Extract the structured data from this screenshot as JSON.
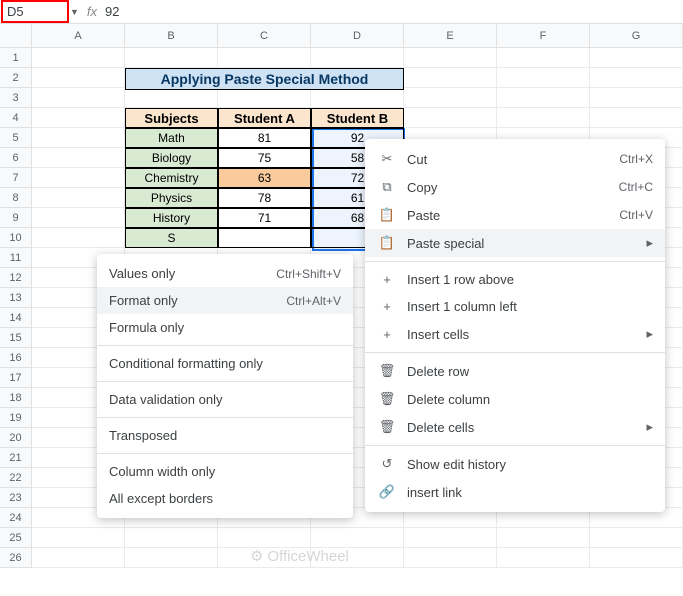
{
  "nameBox": "D5",
  "formulaValue": "92",
  "cols": [
    "A",
    "B",
    "C",
    "D",
    "E",
    "F",
    "G"
  ],
  "title": "Applying Paste Special Method",
  "headers": {
    "b": "Subjects",
    "c": "Student A",
    "d": "Student B"
  },
  "rows": [
    {
      "sub": "Math",
      "a": "81",
      "b": "92"
    },
    {
      "sub": "Biology",
      "a": "75",
      "b": "58"
    },
    {
      "sub": "Chemistry",
      "a": "63",
      "b": "72"
    },
    {
      "sub": "Physics",
      "a": "78",
      "b": "61"
    },
    {
      "sub": "History",
      "a": "71",
      "b": "68"
    },
    {
      "sub": "S",
      "a": "",
      "b": ""
    }
  ],
  "ctx": {
    "cut": "Cut",
    "copy": "Copy",
    "paste": "Paste",
    "pasteSpecial": "Paste special",
    "insRow": "Insert 1 row above",
    "insCol": "Insert 1 column left",
    "insCells": "Insert cells",
    "delRow": "Delete row",
    "delCol": "Delete column",
    "delCells": "Delete cells",
    "history": "Show edit history",
    "link": "insert link",
    "scCut": "Ctrl+X",
    "scCopy": "Ctrl+C",
    "scPaste": "Ctrl+V"
  },
  "sub": {
    "values": "Values only",
    "format": "Format only",
    "formula": "Formula only",
    "cond": "Conditional formatting only",
    "datav": "Data validation only",
    "trans": "Transposed",
    "colw": "Column width only",
    "except": "All except borders",
    "scValues": "Ctrl+Shift+V",
    "scFormat": "Ctrl+Alt+V"
  },
  "watermark": "OfficeWheel"
}
